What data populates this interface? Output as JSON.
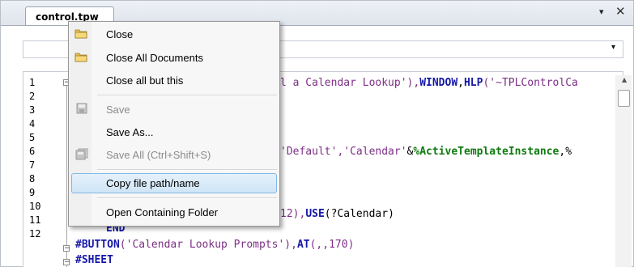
{
  "tab": {
    "title": "control.tpw"
  },
  "window_controls": {
    "dropdown": "▾",
    "close": "✕"
  },
  "combo": {
    "value": "",
    "arrow": "▾"
  },
  "editor": {
    "line_numbers": [
      "1",
      "2",
      "3",
      "4",
      "5",
      "6",
      "7",
      "8",
      "9",
      "10",
      "11",
      "12"
    ],
    "fold_markers": [
      "−",
      "−",
      "−"
    ],
    "code": {
      "l1_str": "l a Calendar Lookup'),",
      "l1_kw1": "WINDOW",
      "l1_sep": ",",
      "l1_kw2": "HLP",
      "l1_tail": "('~TPLControlCa",
      "l5_str": "'Default','Calendar'",
      "l5_amp": "&",
      "l5_kw": "%ActiveTemplateInstance",
      "l5_tail": ",%",
      "l9_num": "12),",
      "l9_kw": "USE",
      "l9_arg": "(?Calendar)",
      "l10_kw": "END",
      "l11_kw": "#BUTTON",
      "l11_str": "('Calendar Lookup Prompts'),",
      "l11_kw2": "AT",
      "l11_tail": "(,,170)",
      "l12_kw": "#SHEET"
    }
  },
  "context_menu": {
    "items": [
      {
        "label": "Close",
        "icon": "folder-icon",
        "enabled": true
      },
      {
        "label": "Close All Documents",
        "icon": "folder-icon",
        "enabled": true
      },
      {
        "label": "Close all but this",
        "icon": "",
        "enabled": true
      },
      {
        "label": "Save",
        "icon": "save-icon",
        "enabled": false
      },
      {
        "label": "Save As...",
        "icon": "",
        "enabled": true
      },
      {
        "label": "Save All  (Ctrl+Shift+S)",
        "icon": "save-all-icon",
        "enabled": false
      },
      {
        "label": "Copy file path/name",
        "icon": "",
        "enabled": true,
        "highlighted": true
      },
      {
        "label": "Open Containing Folder",
        "icon": "",
        "enabled": true
      }
    ]
  },
  "colors": {
    "keyword": "#1518a8",
    "string": "#7d2f86",
    "highlight_border": "#83b8e4",
    "highlight_fill": "#cfe5f7"
  }
}
